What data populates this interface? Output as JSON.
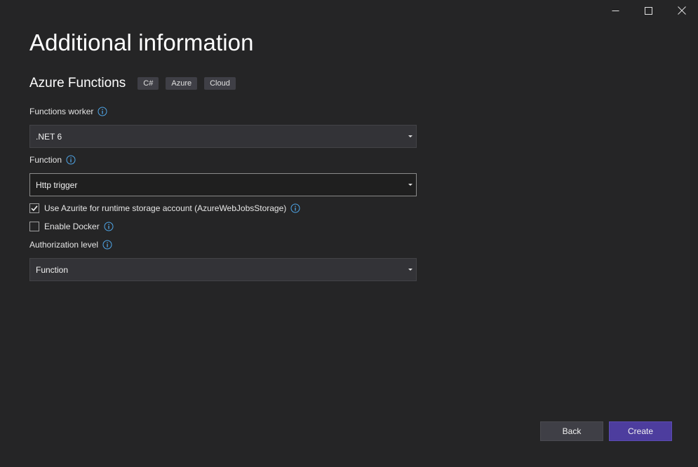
{
  "window": {
    "controls": [
      "minimize-icon",
      "maximize-icon",
      "close-icon"
    ]
  },
  "page": {
    "title": "Additional information"
  },
  "template": {
    "name": "Azure Functions",
    "tags": [
      "C#",
      "Azure",
      "Cloud"
    ]
  },
  "form": {
    "functions_worker": {
      "label": "Functions worker",
      "value": ".NET 6"
    },
    "function": {
      "label": "Function",
      "value": "Http trigger"
    },
    "use_azurite": {
      "label": "Use Azurite for runtime storage account (AzureWebJobsStorage)",
      "checked": true
    },
    "enable_docker": {
      "label": "Enable Docker",
      "checked": false
    },
    "authorization_level": {
      "label": "Authorization level",
      "value": "Function"
    }
  },
  "buttons": {
    "back": "Back",
    "create": "Create"
  },
  "colors": {
    "background": "#252526",
    "info_icon": "#4fa6e8",
    "primary_button": "#4d3d9e"
  }
}
